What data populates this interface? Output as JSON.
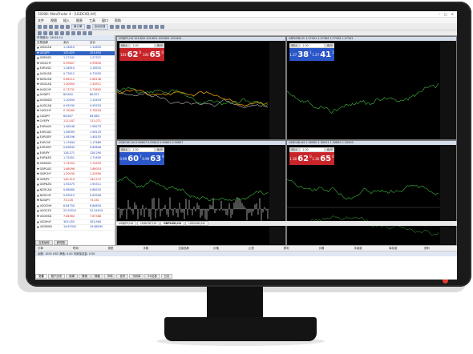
{
  "window": {
    "title": "10008: MetaTrader 4 - [USDCAD,H4]"
  },
  "menu": [
    "文件",
    "视图",
    "插入",
    "图表",
    "工具",
    "窗口",
    "帮助"
  ],
  "toolbar": {
    "new_order_label": "新订单",
    "autotrading_label": "自动交易"
  },
  "market_watch": {
    "header": "市场报价: 16:04:14",
    "columns": [
      "交易品种",
      "卖价",
      "买价"
    ],
    "rows": [
      {
        "symbol": "USDCAD",
        "bid": "1.14810",
        "ask": "1.14830",
        "dir": "up"
      },
      {
        "symbol": "USDJPY",
        "bid": "103.620",
        "ask": "103.650",
        "dir": "dn",
        "selected": true
      },
      {
        "symbol": "GBPUSD",
        "bid": "1.27341",
        "ask": "1.27371",
        "dir": "up"
      },
      {
        "symbol": "USDCHF",
        "bid": "0.99607",
        "ask": "0.99630",
        "dir": "dn"
      },
      {
        "symbol": "EURUSD",
        "bid": "1.18514",
        "ask": "1.18532",
        "dir": "up"
      },
      {
        "symbol": "AUDUSD",
        "bid": "0.73912",
        "ask": "0.73935",
        "dir": "up"
      },
      {
        "symbol": "NZDUSD",
        "bid": "0.66112",
        "ask": "0.66138",
        "dir": "dn"
      },
      {
        "symbol": "USDCAD",
        "bid": "1.30900",
        "ask": "1.30911",
        "dir": "dn"
      },
      {
        "symbol": "AUDCHF",
        "bid": "0.73731",
        "ask": "0.73802",
        "dir": "dn"
      },
      {
        "symbol": "AUDJPY",
        "bid": "80.840",
        "ask": "80.871",
        "dir": "up"
      },
      {
        "symbol": "AUDNZD",
        "bid": "1.10450",
        "ask": "1.10453",
        "dir": "up"
      },
      {
        "symbol": "AUDCAD",
        "bid": "0.95530",
        "ask": "0.95553",
        "dir": "up"
      },
      {
        "symbol": "CADCHF",
        "bid": "0.76260",
        "ask": "0.76294",
        "dir": "dn"
      },
      {
        "symbol": "CADJPY",
        "bid": "84.647",
        "ask": "84.684",
        "dir": "up"
      },
      {
        "symbol": "CHFJPY",
        "bid": "111.047",
        "ask": "111.071",
        "dir": "dn"
      },
      {
        "symbol": "EURAUD",
        "bid": "1.58246",
        "ask": "1.58273",
        "dir": "up"
      },
      {
        "symbol": "EURCAD",
        "bid": "1.56095",
        "ask": "1.56125",
        "dir": "up"
      },
      {
        "symbol": "EURGBP",
        "bid": "1.48196",
        "ask": "1.48155",
        "dir": "up"
      },
      {
        "symbol": "EURCHF",
        "bid": "1.17644",
        "ask": "1.17689",
        "dir": "up"
      },
      {
        "symbol": "EURGBP",
        "bid": "0.89840",
        "ask": "0.89846",
        "dir": "up"
      },
      {
        "symbol": "EURJPY",
        "bid": "126.271",
        "ask": "126.290",
        "dir": "up"
      },
      {
        "symbol": "EURNZD",
        "bid": "1.72051",
        "ask": "1.71630",
        "dir": "up"
      },
      {
        "symbol": "GBPAUD",
        "bid": "1.74554",
        "ask": "1.74555",
        "dir": "dn"
      },
      {
        "symbol": "GBPCAD",
        "bid": "1.68096",
        "ask": "1.66053",
        "dir": "dn"
      },
      {
        "symbol": "GBPCHF",
        "bid": "1.20930",
        "ask": "1.20990",
        "dir": "dn"
      },
      {
        "symbol": "GBPJPY",
        "bid": "140.510",
        "ask": "140.572",
        "dir": "dn"
      },
      {
        "symbol": "GBPNZD",
        "bid": "1.92475",
        "ask": "1.92511",
        "dir": "up"
      },
      {
        "symbol": "NZDCAD",
        "bid": "0.86480",
        "ask": "0.86520",
        "dir": "up"
      },
      {
        "symbol": "NZDCHF",
        "bid": "0.63915",
        "ask": "0.63956",
        "dir": "up"
      },
      {
        "symbol": "NZDJPY",
        "bid": "73.228",
        "ask": "73.261",
        "dir": "dn"
      },
      {
        "symbol": "USDCNH",
        "bid": "6.84750",
        "ask": "6.84854",
        "dir": "up"
      },
      {
        "symbol": "USDCZK",
        "bid": "22.55515",
        "ask": "22.54915",
        "dir": "up"
      },
      {
        "symbol": "USDHKD",
        "bid": "7.84564",
        "ask": "7.87368",
        "dir": "dn"
      },
      {
        "symbol": "USDHUF",
        "bid": "303.055",
        "ask": "303.564",
        "dir": "up"
      },
      {
        "symbol": "USDMXN",
        "bid": "19.87920",
        "ask": "19.88930",
        "dir": "up"
      }
    ],
    "tabs": [
      "交易品种",
      "即时图"
    ]
  },
  "charts": [
    {
      "title": "USDJPY,H4  103.620 103.651 103.602 103.620",
      "symbol": "USDJPY",
      "sell": "62",
      "sell_prefix": "103",
      "sell_sup": "0",
      "buy": "65",
      "buy_prefix": "103",
      "buy_sup": "0",
      "lot": "1.00",
      "accent": "#c8252a"
    },
    {
      "title": "GBPUSD,H1  1.27341 1.27364 1.27334 1.27341",
      "symbol": "GBPUSD",
      "sell": "38",
      "sell_prefix": "1.27",
      "sell_sup": "1",
      "buy": "41",
      "buy_prefix": "1.27",
      "buy_sup": "1",
      "lot": "1.00",
      "accent": "#2a56c8"
    },
    {
      "title": "USDCHF,H4  0.99607 0.99615 0.99601 0.99607",
      "symbol": "USDCHF",
      "sell": "60",
      "sell_prefix": "0.99",
      "sell_sup": "7",
      "buy": "63",
      "buy_prefix": "0.99",
      "buy_sup": "0",
      "lot": "1.00",
      "accent": "#2a56c8"
    },
    {
      "title": "USDCAD,H4  1.30900 1.30911 1.30890 1.30900",
      "symbol": "USDCAD",
      "sell": "62",
      "sell_prefix": "1.30",
      "sell_sup": "0",
      "buy": "65",
      "buy_prefix": "1.30",
      "buy_sup": "0",
      "lot": "1.00",
      "accent": "#c8252a"
    }
  ],
  "chart_tabs": [
    "USDJPY,H4",
    "USDCHF,H4",
    "GBPUSD,H1",
    "USDCAD,H4"
  ],
  "terminal": {
    "columns": [
      "订单",
      "时间",
      "类型",
      "手数",
      "交易品种",
      "价格",
      "止损",
      "获利",
      "价格",
      "手续费",
      "库存费",
      "获利"
    ],
    "balance": "余额: 1000 USD  净值: 0.00  可用保证金: 0.00",
    "tabs": [
      "交易",
      "账户历史",
      "新闻",
      "警报",
      "邮箱",
      "市场",
      "信号",
      "代码库",
      "EA交易",
      "日志"
    ]
  }
}
